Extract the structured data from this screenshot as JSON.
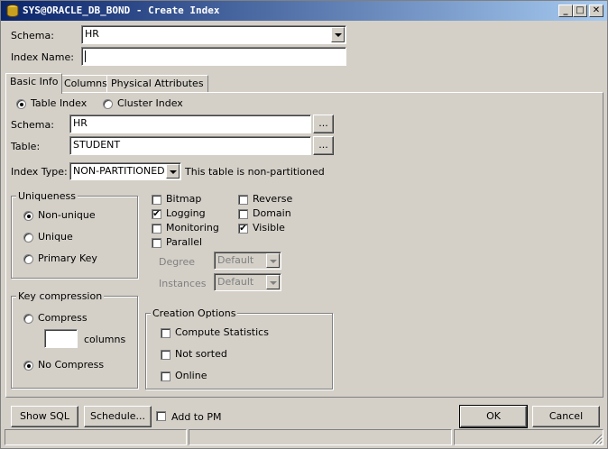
{
  "window": {
    "title": "SYS@ORACLE_DB_BOND - Create Index",
    "minimize": "_",
    "maximize": "□",
    "close": "✕"
  },
  "header": {
    "schema_label": "Schema:",
    "schema_value": "HR",
    "index_name_label": "Index Name:",
    "index_name_value": ""
  },
  "tabs": [
    {
      "label": "Basic Info",
      "active": true
    },
    {
      "label": "Columns"
    },
    {
      "label": "Physical Attributes"
    }
  ],
  "basic": {
    "table_index_label": "Table Index",
    "cluster_index_label": "Cluster Index",
    "schema_label": "Schema:",
    "schema_value": "HR",
    "table_label": "Table:",
    "table_value": "STUDENT",
    "browse_label": "...",
    "index_type_label": "Index Type:",
    "index_type_value": "NON-PARTITIONED",
    "partition_note": "This table is non-partitioned"
  },
  "uniqueness": {
    "title": "Uniqueness",
    "options": [
      "Non-unique",
      "Unique",
      "Primary Key"
    ],
    "selected": "Non-unique"
  },
  "options": {
    "bitmap": "Bitmap",
    "logging": "Logging",
    "monitoring": "Monitoring",
    "parallel": "Parallel",
    "reverse": "Reverse",
    "domain": "Domain",
    "visible": "Visible",
    "degree_label": "Degree",
    "degree_value": "Default",
    "instances_label": "Instances",
    "instances_value": "Default",
    "check_mark": "✔"
  },
  "key_compression": {
    "title": "Key compression",
    "compress_label": "Compress",
    "columns_label": "columns",
    "columns_value": "",
    "no_compress_label": "No Compress"
  },
  "creation": {
    "title": "Creation Options",
    "compute_statistics": "Compute Statistics",
    "not_sorted": "Not sorted",
    "online": "Online"
  },
  "footer": {
    "show_sql": "Show SQL",
    "schedule": "Schedule...",
    "add_to_pm": "Add to PM",
    "ok": "OK",
    "cancel": "Cancel"
  }
}
